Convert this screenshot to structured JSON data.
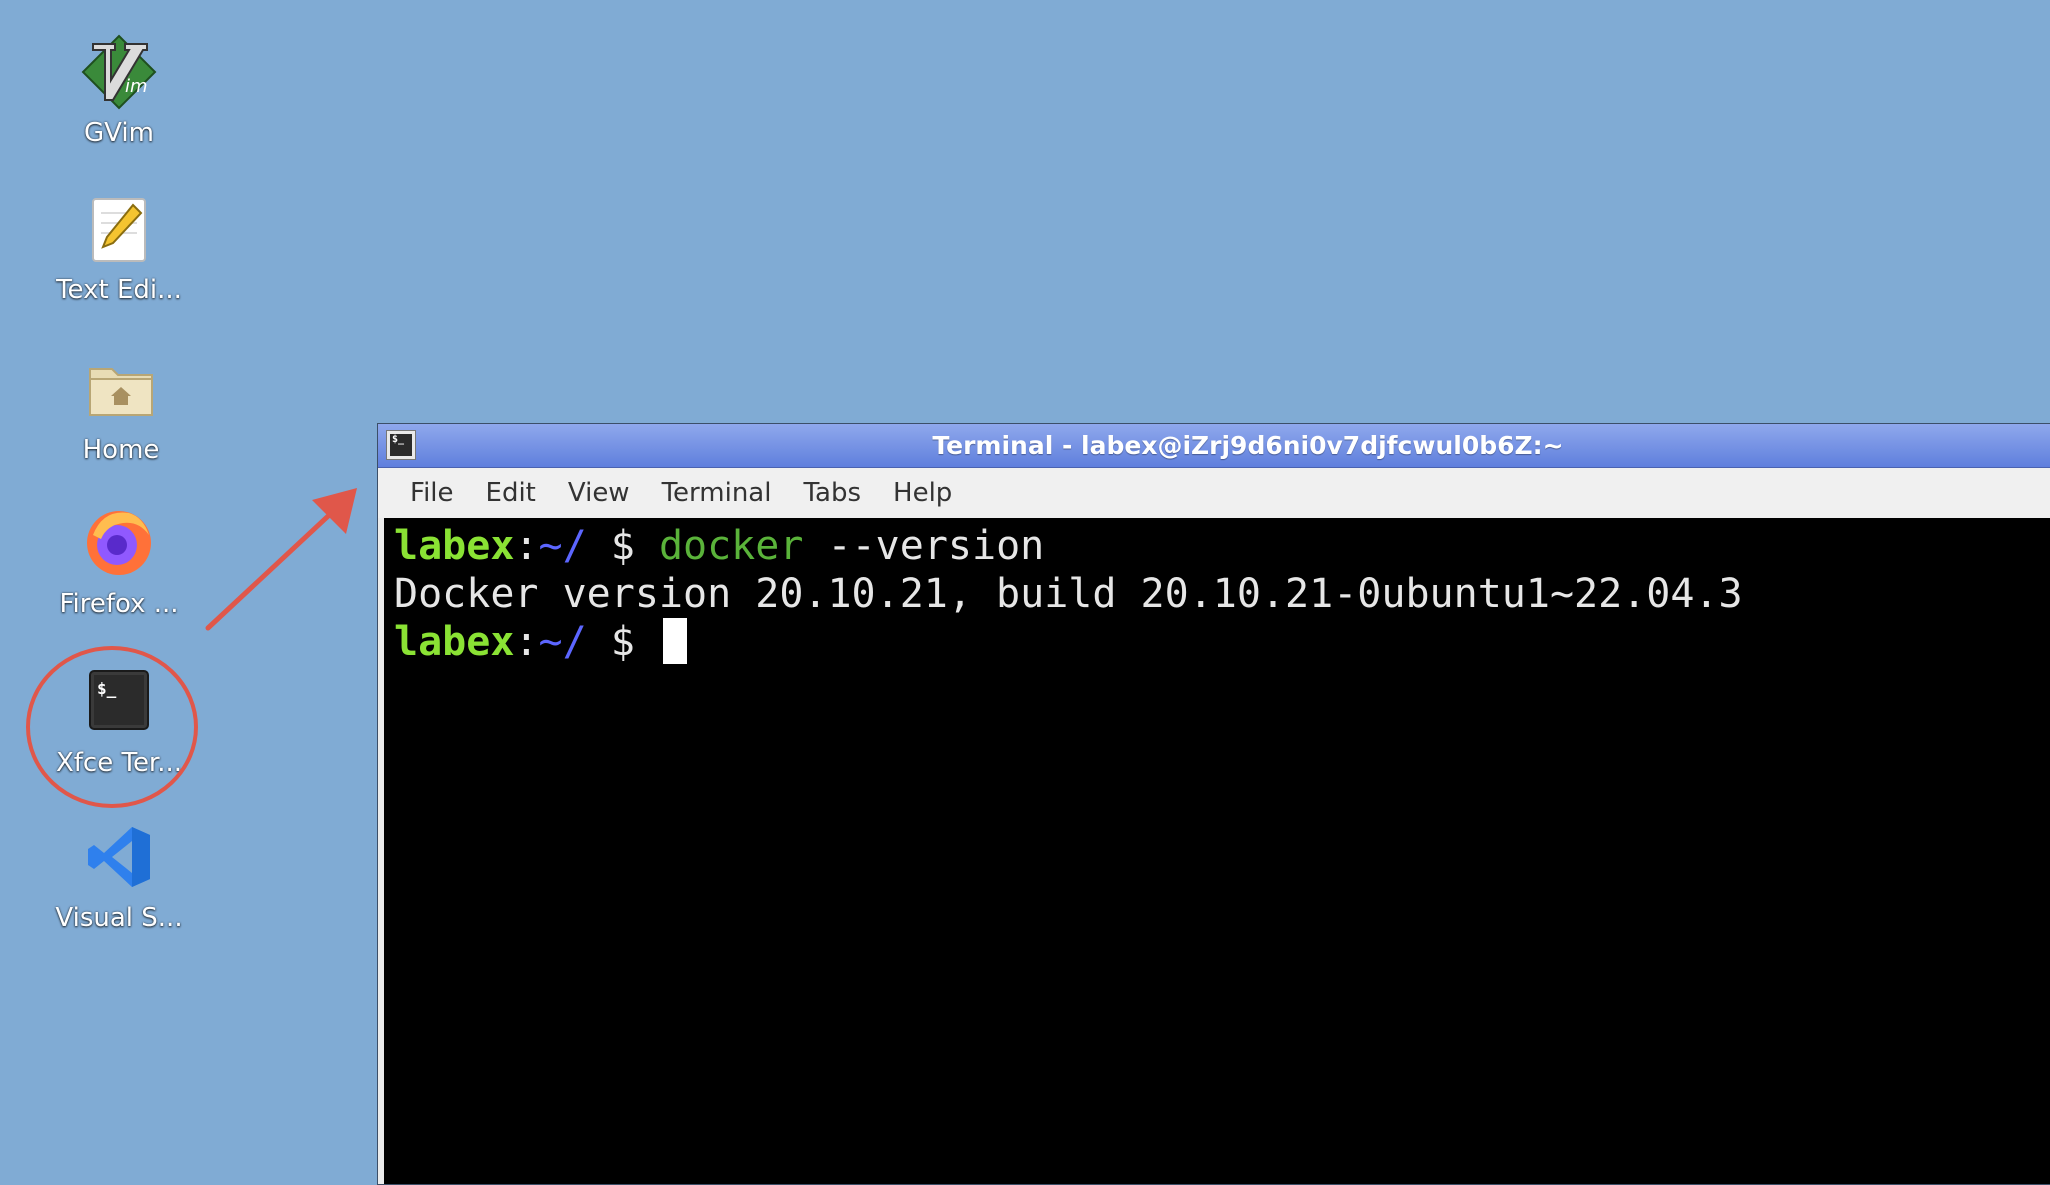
{
  "desktop": {
    "icons": [
      {
        "label": "GVim"
      },
      {
        "label": "Text Edi..."
      },
      {
        "label": "Home"
      },
      {
        "label": "Firefox ..."
      },
      {
        "label": "Xfce Ter..."
      },
      {
        "label": "Visual S..."
      }
    ]
  },
  "window": {
    "title": "Terminal - labex@iZrj9d6ni0v7djfcwul0b6Z:~",
    "menu": [
      "File",
      "Edit",
      "View",
      "Terminal",
      "Tabs",
      "Help"
    ]
  },
  "terminal": {
    "lines": [
      {
        "user": "labex",
        "sep": ":",
        "path": "~/",
        "prompt": " $ ",
        "cmd": "docker",
        "args": " --version"
      },
      {
        "output": "Docker version 20.10.21, build 20.10.21-0ubuntu1~22.04.3"
      },
      {
        "user": "labex",
        "sep": ":",
        "path": "~/",
        "prompt": " $ "
      }
    ]
  },
  "annotation": {
    "color": "#e0574a"
  }
}
